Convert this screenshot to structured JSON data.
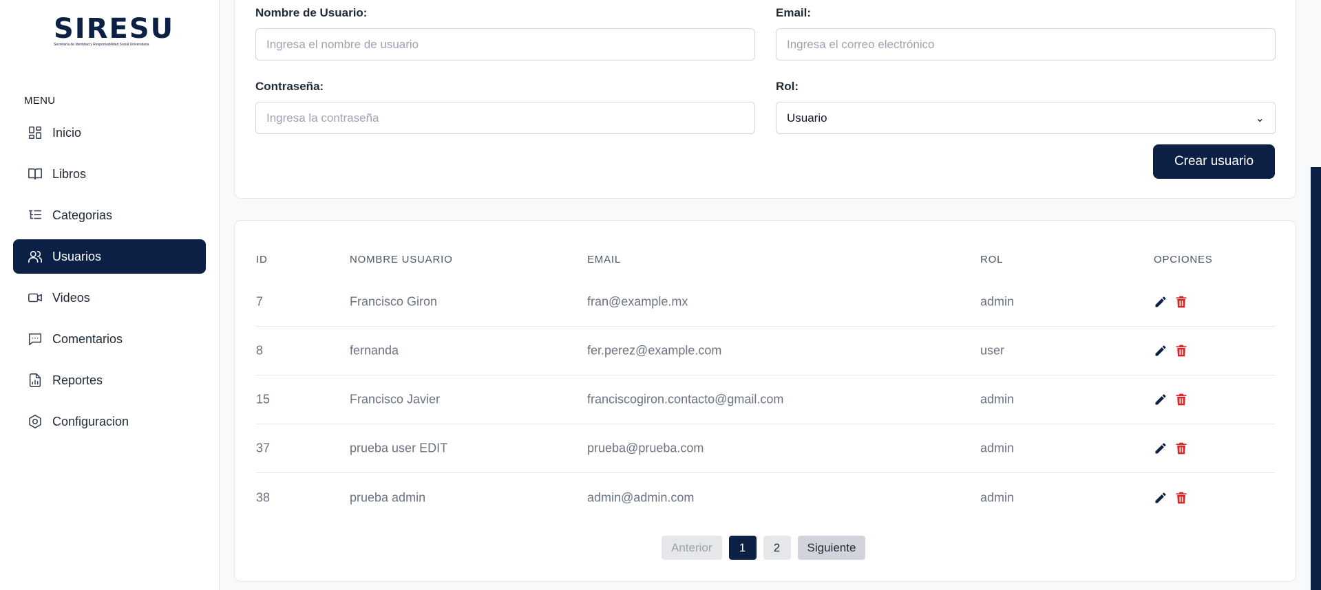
{
  "brand": {
    "logo_text": "SIRESU",
    "logo_subtitle": "Secretaría de Identidad y Responsabilidad Social Universitaria"
  },
  "sidebar": {
    "menu_title": "MENU",
    "items": [
      {
        "label": "Inicio",
        "icon": "dashboard-icon"
      },
      {
        "label": "Libros",
        "icon": "book-icon"
      },
      {
        "label": "Categorias",
        "icon": "list-icon"
      },
      {
        "label": "Usuarios",
        "icon": "users-icon",
        "active": true
      },
      {
        "label": "Videos",
        "icon": "video-icon"
      },
      {
        "label": "Comentarios",
        "icon": "comment-icon"
      },
      {
        "label": "Reportes",
        "icon": "report-icon"
      },
      {
        "label": "Configuracion",
        "icon": "settings-icon"
      }
    ]
  },
  "form": {
    "username": {
      "label": "Nombre de Usuario:",
      "placeholder": "Ingresa el nombre de usuario"
    },
    "email": {
      "label": "Email:",
      "placeholder": "Ingresa el correo electrónico"
    },
    "password": {
      "label": "Contraseña:",
      "placeholder": "Ingresa la contraseña"
    },
    "role": {
      "label": "Rol:",
      "value": "Usuario"
    },
    "submit_label": "Crear usuario"
  },
  "table": {
    "headers": {
      "id": "ID",
      "name": "NOMBRE USUARIO",
      "email": "EMAIL",
      "role": "ROL",
      "options": "OPCIONES"
    },
    "rows": [
      {
        "id": "7",
        "name": "Francisco Giron",
        "email": "fran@example.mx",
        "role": "admin"
      },
      {
        "id": "8",
        "name": "fernanda",
        "email": "fer.perez@example.com",
        "role": "user"
      },
      {
        "id": "15",
        "name": "Francisco Javier",
        "email": "franciscogiron.contacto@gmail.com",
        "role": "admin"
      },
      {
        "id": "37",
        "name": "prueba user EDIT",
        "email": "prueba@prueba.com",
        "role": "admin"
      },
      {
        "id": "38",
        "name": "prueba admin",
        "email": "admin@admin.com",
        "role": "admin"
      }
    ]
  },
  "pagination": {
    "prev_label": "Anterior",
    "pages": [
      "1",
      "2"
    ],
    "current_page": "1",
    "next_label": "Siguiente"
  },
  "colors": {
    "primary": "#0c1f44",
    "danger": "#dc2626"
  }
}
